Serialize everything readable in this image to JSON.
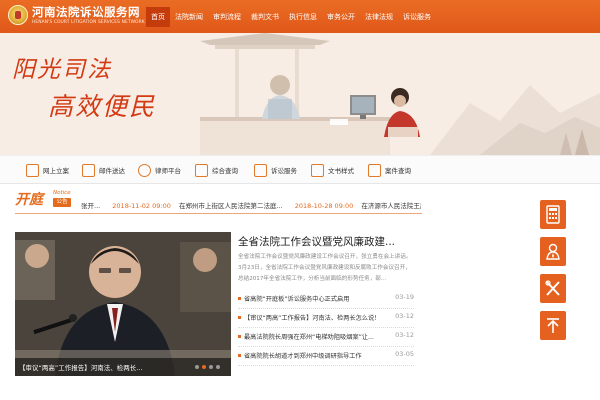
{
  "header": {
    "logo_cn": "河南法院诉讼服务网",
    "logo_en": "HENAN'S COURT LITIGATION SERVICES NETWORK",
    "nav": [
      "首页",
      "法院新闻",
      "审判流程",
      "裁判文书",
      "执行信息",
      "审务公开",
      "法律法规",
      "诉讼服务"
    ]
  },
  "banner": {
    "slogan_line1": "阳光司法",
    "slogan_line2": "高效便民"
  },
  "services": [
    {
      "label": "网上立案",
      "icon": "file-upload-icon"
    },
    {
      "label": "邮件送达",
      "icon": "mail-icon"
    },
    {
      "label": "律师平台",
      "icon": "lawyer-icon"
    },
    {
      "label": "综合查询",
      "icon": "search-document-icon"
    },
    {
      "label": "诉讼服务",
      "icon": "scales-icon"
    },
    {
      "label": "文书样式",
      "icon": "book-icon"
    },
    {
      "label": "案件查询",
      "icon": "court-building-icon"
    }
  ],
  "notice": {
    "title": "开庭",
    "title_en": "Notice",
    "badge": "公告",
    "items": [
      {
        "date": "",
        "text": "张开..."
      },
      {
        "date": "2018-11-02 09:00",
        "text": "在郑州市上街区人民法院第二法庭..."
      },
      {
        "date": "2018-10-28 09:00",
        "text": "在济源市人民法院王屋一法..."
      }
    ]
  },
  "photo": {
    "caption": "【审议“两高”工作报告】河南法、检两长..."
  },
  "main_news": {
    "headline": "全省法院工作会议暨党风廉政建...",
    "summary": "全省法院工作会议暨党风廉政建设工作会议召开，张立勇在会上讲话。3月23日，全省法院工作会议暨党风廉政建设和反腐败工作会议召开，总结2017年全省法院工作，分析当前面临的形势任务，部..."
  },
  "news_list": [
    {
      "title": "省高院“开庭板”诉讼服务中心正式启用",
      "date": "03-19"
    },
    {
      "title": "【审议“两高”工作报告】河南法、检两长怎么说！",
      "date": "03-12"
    },
    {
      "title": "最高法院院长周强在郑州“电梯劝阻吸烟案”让...",
      "date": "03-12"
    },
    {
      "title": "省高院院长胡道才到郑州中级调研指导工作",
      "date": "03-05"
    }
  ],
  "side_tools": [
    {
      "name": "calculator-icon"
    },
    {
      "name": "user-service-icon"
    },
    {
      "name": "tools-icon"
    },
    {
      "name": "back-to-top-icon"
    }
  ],
  "colors": {
    "primary": "#e0581a",
    "accent": "#e46b1d",
    "slogan": "#d33a14",
    "nav_active": "#c43c0c"
  }
}
